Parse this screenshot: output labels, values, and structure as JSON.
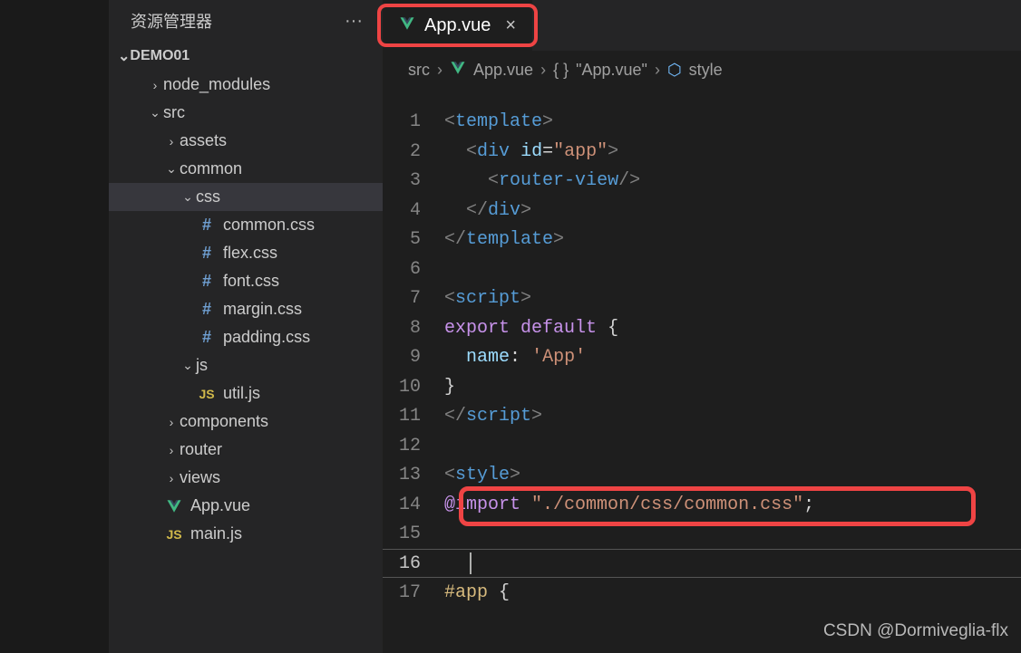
{
  "sidebar": {
    "title": "资源管理器",
    "project": "DEMO01",
    "tree": {
      "node_modules": "node_modules",
      "src": "src",
      "assets": "assets",
      "common": "common",
      "css": "css",
      "common_css": "common.css",
      "flex_css": "flex.css",
      "font_css": "font.css",
      "margin_css": "margin.css",
      "padding_css": "padding.css",
      "js": "js",
      "util_js": "util.js",
      "components": "components",
      "router": "router",
      "views": "views",
      "app_vue": "App.vue",
      "main_js": "main.js"
    }
  },
  "tab": {
    "label": "App.vue"
  },
  "breadcrumbs": {
    "src": "src",
    "file": "App.vue",
    "scope": "\"App.vue\"",
    "symbol": "style"
  },
  "code": {
    "lines": [
      "1",
      "2",
      "3",
      "4",
      "5",
      "6",
      "7",
      "8",
      "9",
      "10",
      "11",
      "12",
      "13",
      "14",
      "15",
      "16",
      "17"
    ],
    "l1_tag": "template",
    "l2_tag": "div",
    "l2_attr": "id",
    "l2_val": "\"app\"",
    "l3_tag": "router-view",
    "l4_tag": "div",
    "l5_tag": "template",
    "l7_tag": "script",
    "l8_export": "export",
    "l8_default": "default",
    "l9_name": "name",
    "l9_val": "'App'",
    "l11_tag": "script",
    "l13_tag": "style",
    "l14_at": "@import",
    "l14_path": "\"./common/css/common.css\"",
    "l17_sel": "#app"
  },
  "watermark": "CSDN @Dormiveglia-flx"
}
